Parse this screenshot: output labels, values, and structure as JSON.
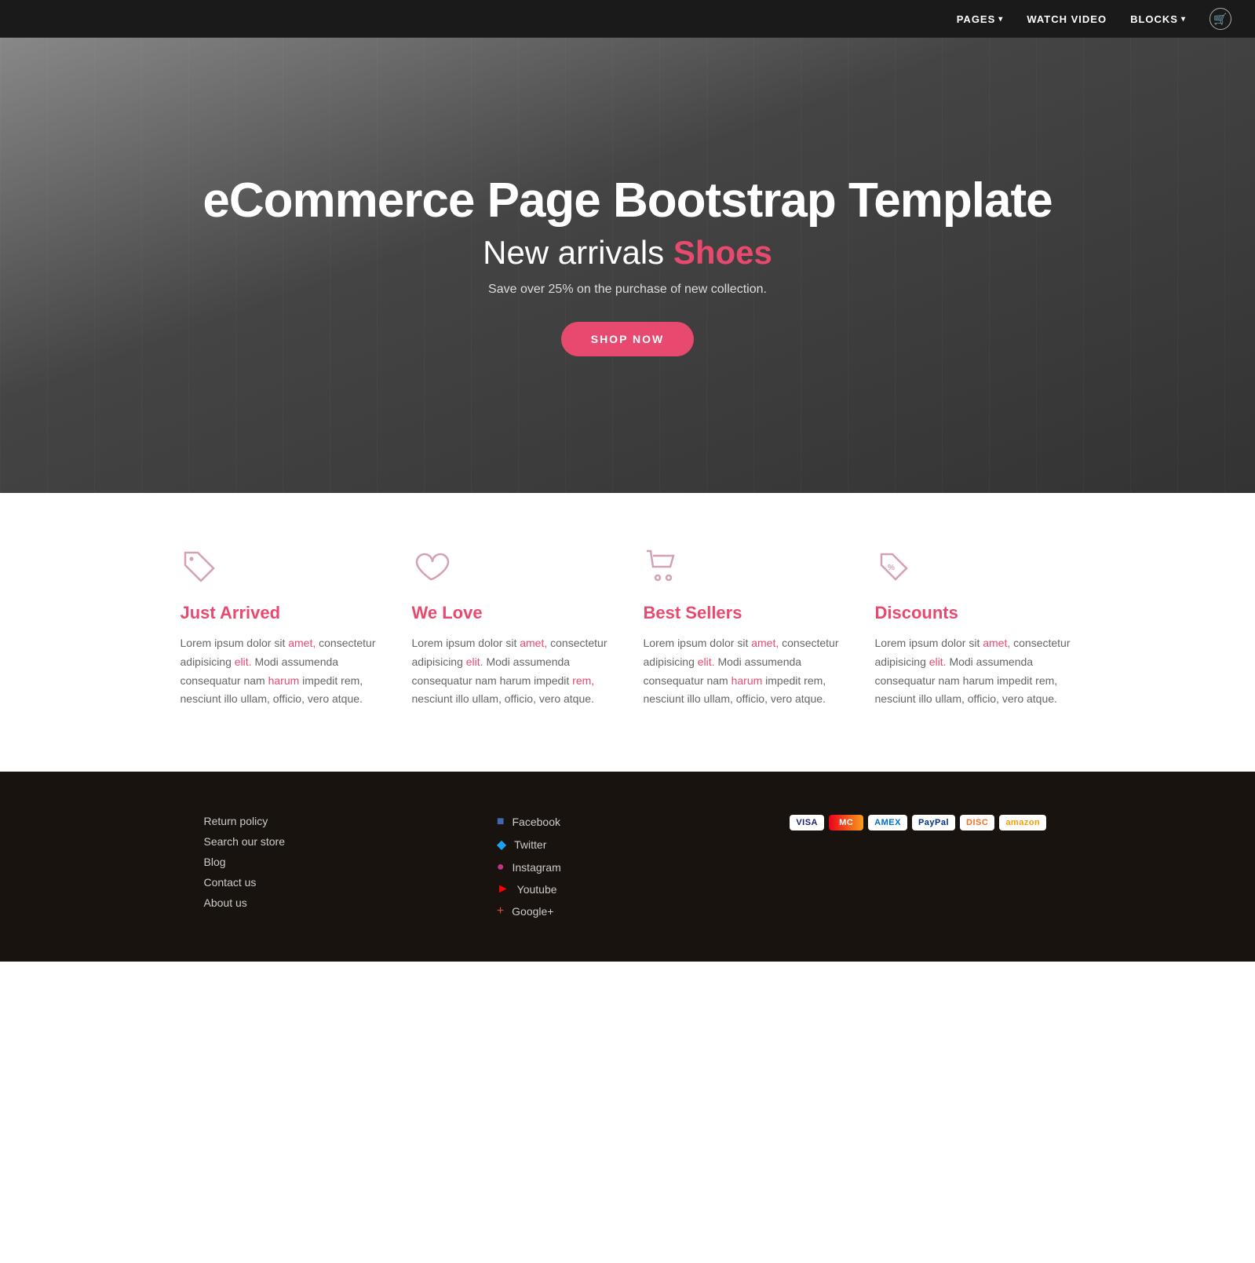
{
  "navbar": {
    "items": [
      {
        "label": "PAGES",
        "hasDropdown": true
      },
      {
        "label": "WATCH VIDEO",
        "hasDropdown": false
      },
      {
        "label": "BLOCKS",
        "hasDropdown": true
      }
    ],
    "cart_icon": "cart-icon"
  },
  "hero": {
    "title": "eCommerce Page Bootstrap Template",
    "subtitle_prefix": "New arrivals ",
    "subtitle_highlight": "Shoes",
    "description": "Save over 25% on the purchase of new collection.",
    "cta_label": "SHOP NOW"
  },
  "features": [
    {
      "id": "just-arrived",
      "icon": "tag-icon",
      "title": "Just Arrived",
      "text": "Lorem ipsum dolor sit amet, consectetur adipisicing elit. Modi assumenda consequatur nam harum impedit rem, nesciunt illo ullam, officio, vero atque.",
      "highlight_words": [
        "amet,",
        "elit.",
        "harum"
      ]
    },
    {
      "id": "we-love",
      "icon": "heart-icon",
      "title": "We Love",
      "text": "Lorem ipsum dolor sit amet, consectetur adipisicing elit. Modi assumenda consequatur nam harum impedit rem, nesciunt illo ullam, officio, vero atque.",
      "highlight_words": [
        "amet,",
        "elit.",
        "rem,"
      ]
    },
    {
      "id": "best-sellers",
      "icon": "cart-icon",
      "title": "Best Sellers",
      "text": "Lorem ipsum dolor sit amet, consectetur adipisicing elit. Modi assumenda consequatur nam harum impedit rem, nesciunt illo ullam, officio, vero atque.",
      "highlight_words": [
        "amet,",
        "elit.",
        "harum"
      ]
    },
    {
      "id": "discounts",
      "icon": "discount-icon",
      "title": "Discounts",
      "text": "Lorem ipsum dolor sit amet, consectetur adipisicing elit. Modi assumenda consequatur nam harum impedit rem, nesciunt illo ullam, officio, vero atque.",
      "highlight_words": [
        "amet,",
        "elit."
      ]
    }
  ],
  "footer": {
    "links": [
      {
        "label": "Return policy"
      },
      {
        "label": "Search our store"
      },
      {
        "label": "Blog"
      },
      {
        "label": "Contact us"
      },
      {
        "label": "About us"
      }
    ],
    "social": [
      {
        "label": "Facebook",
        "icon": "facebook-icon"
      },
      {
        "label": "Twitter",
        "icon": "twitter-icon"
      },
      {
        "label": "Instagram",
        "icon": "instagram-icon"
      },
      {
        "label": "Youtube",
        "icon": "youtube-icon"
      },
      {
        "label": "Google+",
        "icon": "googleplus-icon"
      }
    ],
    "payment_methods": [
      "VISA",
      "MC",
      "AMEX",
      "PayPal",
      "Discover",
      "Amazon"
    ]
  }
}
